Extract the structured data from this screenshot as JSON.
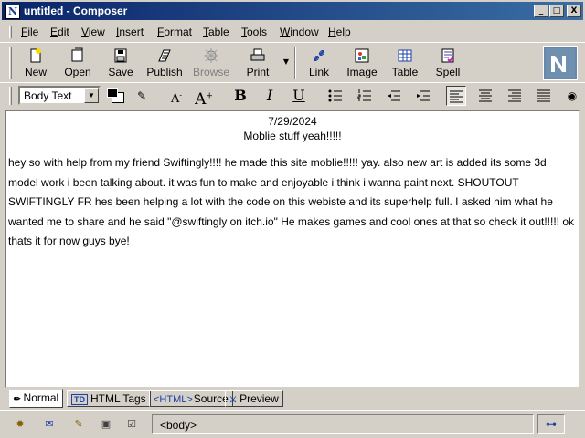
{
  "window": {
    "title": "untitled - Composer",
    "buttons": [
      "_",
      "□",
      "X"
    ]
  },
  "menu": [
    "File",
    "Edit",
    "View",
    "Insert",
    "Format",
    "Table",
    "Tools",
    "Window",
    "Help"
  ],
  "toolbar": {
    "new": "New",
    "open": "Open",
    "save": "Save",
    "publish": "Publish",
    "browse": "Browse",
    "print": "Print",
    "link": "Link",
    "image": "Image",
    "table": "Table",
    "spell": "Spell"
  },
  "format": {
    "paragraph_style": "Body Text",
    "text_color": "#000000",
    "background_color": "#ffffff",
    "icons": [
      "highlight-icon",
      "font-smaller-icon",
      "font-larger-icon",
      "bold-icon",
      "italic-icon",
      "underline-icon",
      "bullet-list-icon",
      "numbered-list-icon",
      "outdent-icon",
      "indent-icon",
      "align-left-icon",
      "align-center-icon",
      "align-right-icon",
      "justify-icon"
    ],
    "bold": "B",
    "italic": "I",
    "underline": "U"
  },
  "document": {
    "date": "7/29/2024",
    "subtitle": "Moblie stuff yeah!!!!!",
    "body": "hey so with help from my friend Swiftingly!!!! he made this site moblie!!!!! yay. also new art is added its some 3d model work i been talking about. it was fun to make and enjoyable i think i wanna paint next. SHOUTOUT SWIFTINGLY FR hes been helping a lot with the code on this webiste and its superhelp full. I asked him what he wanted me to share and he said \"@swiftingly on itch.io\" He makes games and cool ones at that so check it out!!!!! ok thats it for now guys bye!"
  },
  "tabs": [
    {
      "label": "Normal",
      "active": true
    },
    {
      "label": "HTML Tags",
      "active": false
    },
    {
      "label": "Source",
      "active": false
    },
    {
      "label": "Preview",
      "active": false
    }
  ],
  "tab_icons": {
    "html_tags": "TD",
    "source_open": "<HTML>"
  },
  "status": {
    "path": "<body>"
  }
}
